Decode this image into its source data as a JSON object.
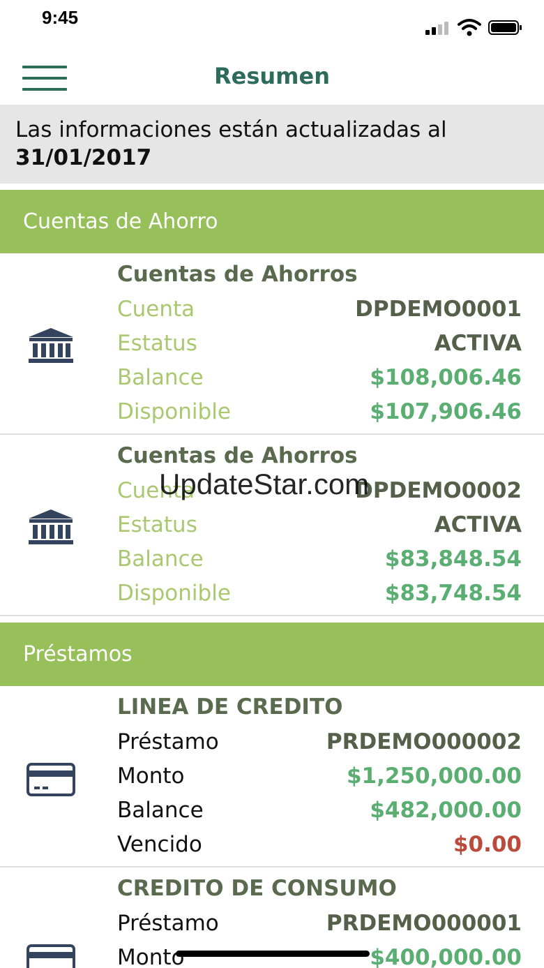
{
  "status_bar": {
    "time": "9:45"
  },
  "nav": {
    "title": "Resumen",
    "menu_icon": "hamburger-icon"
  },
  "update_banner": {
    "line1": "Las informaciones están actualizadas al",
    "date": "31/01/2017"
  },
  "savings": {
    "header": "Cuentas de Ahorro",
    "accounts": [
      {
        "icon": "bank-icon",
        "title": "Cuentas de Ahorros",
        "rows": [
          {
            "label": "Cuenta",
            "value": "DPDEMO0001"
          },
          {
            "label": "Estatus",
            "value": "ACTIVA"
          },
          {
            "label": "Balance",
            "value": "$108,006.46"
          },
          {
            "label": "Disponible",
            "value": "$107,906.46"
          }
        ]
      },
      {
        "icon": "bank-icon",
        "title": "Cuentas de Ahorros",
        "rows": [
          {
            "label": "Cuenta",
            "value": "DPDEMO0002"
          },
          {
            "label": "Estatus",
            "value": "ACTIVA"
          },
          {
            "label": "Balance",
            "value": "$83,848.54"
          },
          {
            "label": "Disponible",
            "value": "$83,748.54"
          }
        ]
      }
    ]
  },
  "loans": {
    "header": "Préstamos",
    "accounts": [
      {
        "icon": "credit-card-icon",
        "title": "LINEA DE CREDITO",
        "rows": [
          {
            "label": "Préstamo",
            "value": "PRDEMO000002"
          },
          {
            "label": "Monto",
            "value": "$1,250,000.00"
          },
          {
            "label": "Balance",
            "value": "$482,000.00"
          },
          {
            "label": "Vencido",
            "value": "$0.00"
          }
        ]
      },
      {
        "icon": "credit-card-icon",
        "title": "CREDITO DE CONSUMO",
        "rows": [
          {
            "label": "Préstamo",
            "value": "PRDEMO000001"
          },
          {
            "label": "Monto",
            "value": "$400,000.00"
          }
        ]
      }
    ]
  },
  "watermark": "UpdateStar.com",
  "colors": {
    "brand_green": "#2d6b5a",
    "section_green": "#97c05a",
    "label_green": "#a9c870",
    "money_green": "#5aae72",
    "overdue_red": "#b94a3c",
    "icon_navy": "#34435e"
  }
}
